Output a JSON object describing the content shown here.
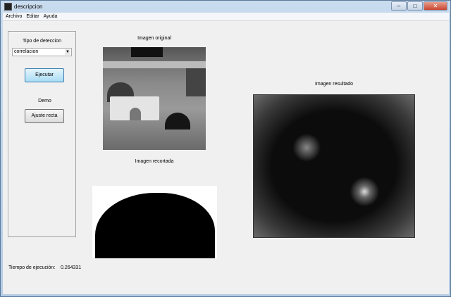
{
  "window": {
    "title": "descripcion",
    "minimize": "–",
    "maximize": "□",
    "close": "✕"
  },
  "menu": [
    "Archivo",
    "Editar",
    "Ayuda"
  ],
  "panel": {
    "detection_label": "Tipo de deteccion",
    "detection_value": "correlacion",
    "execute": "Ejecutar",
    "demo_label": "Demo",
    "fit_line": "Ajuste recta"
  },
  "images": {
    "original": "Imagen original",
    "cropped": "Imagen recortada",
    "result": "Imagen resultado"
  },
  "timing": {
    "label": "Tiempo de ejecución:",
    "value": "0.264331"
  }
}
